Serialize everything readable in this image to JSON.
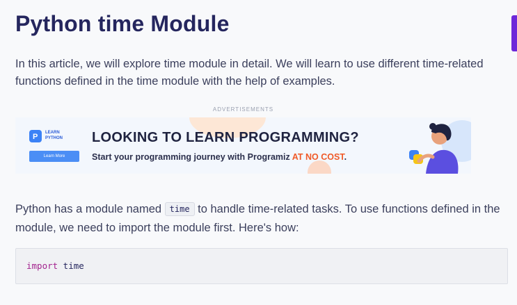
{
  "article": {
    "title": "Python time Module",
    "intro": "In this article, we will explore time module in detail. We will learn to use different time-related functions defined in the time module with the help of examples."
  },
  "advertisement": {
    "label": "ADVERTISEMENTS",
    "logo_line1": "LEARN",
    "logo_line2": "PYTHON",
    "cta_label": "Learn More",
    "headline": "LOOKING TO LEARN PROGRAMMING?",
    "subline_prefix": "Start your programming journey with Programiz ",
    "subline_accent": "AT NO COST",
    "subline_suffix": ".",
    "accent_color": "#f05a28"
  },
  "body": {
    "text_before": "Python has a module named ",
    "inline_code": "time",
    "text_after": " to handle time-related tasks. To use functions defined in the module, we need to import the module first. Here's how:"
  },
  "code_block": {
    "keyword": "import",
    "rest": " time"
  },
  "colors": {
    "title": "#25265e",
    "body_text": "#3b3f5c",
    "keyword": "#a3238e",
    "accent_tab": "#6d28d9"
  }
}
